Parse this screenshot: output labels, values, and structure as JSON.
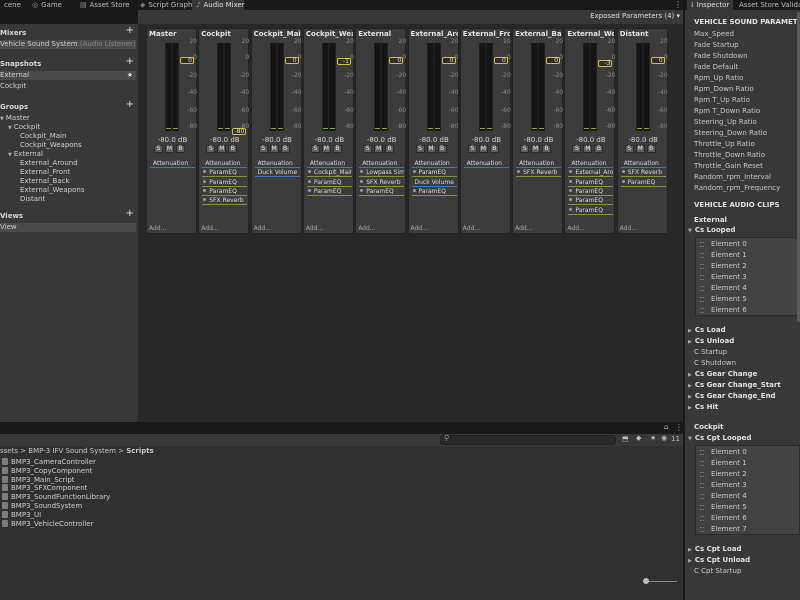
{
  "tabs": [
    {
      "label": "cene",
      "icon": "scene-icon",
      "active": false
    },
    {
      "label": "Game",
      "icon": "game-icon",
      "active": false
    },
    {
      "label": "Asset Store",
      "icon": "store-icon",
      "active": false
    },
    {
      "label": "Script Graph",
      "icon": "graph-icon",
      "active": false
    },
    {
      "label": "Audio Mixer",
      "icon": "mixer-icon",
      "active": true
    }
  ],
  "toolbar": {
    "exposed_params": "Exposed Parameters (4) ▾"
  },
  "left": {
    "mixers_title": "Mixers",
    "mixer_item": "Vehicle Sound System",
    "mixer_item_sub": "(Audio Listener) - Ii",
    "snapshots_title": "Snapshots",
    "snapshots": [
      "External",
      "Cockpit"
    ],
    "snapshot_star": "★",
    "groups_title": "Groups",
    "groups": [
      {
        "label": "Master",
        "indent": 0,
        "arrow": "▼"
      },
      {
        "label": "Cockpit",
        "indent": 1,
        "arrow": "▼"
      },
      {
        "label": "Cockpit_Main",
        "indent": 2,
        "arrow": ""
      },
      {
        "label": "Cockpit_Weapons",
        "indent": 2,
        "arrow": ""
      },
      {
        "label": "External",
        "indent": 1,
        "arrow": "▼"
      },
      {
        "label": "External_Around",
        "indent": 2,
        "arrow": ""
      },
      {
        "label": "External_Front",
        "indent": 2,
        "arrow": ""
      },
      {
        "label": "External_Back",
        "indent": 2,
        "arrow": ""
      },
      {
        "label": "External_Weapons",
        "indent": 2,
        "arrow": ""
      },
      {
        "label": "Distant",
        "indent": 2,
        "arrow": ""
      }
    ],
    "views_title": "Views",
    "views": [
      "View"
    ]
  },
  "meter_ticks": [
    "20",
    "0",
    "-20",
    "-40",
    "-60",
    "-80"
  ],
  "solo_mute_bypass": [
    "S",
    "M",
    "B"
  ],
  "add_label": "Add...",
  "strips": [
    {
      "name": "Master",
      "db": "-80.0 dB",
      "level": "0",
      "fader_db": 0,
      "effects": [
        {
          "label": "Attenuation",
          "plain": true,
          "dot": false
        }
      ]
    },
    {
      "name": "Cockpit",
      "db": "-80.0 dB",
      "level": "-80",
      "fader_db": -80,
      "effects": [
        {
          "label": "Attenuation",
          "plain": true,
          "dot": false
        },
        {
          "label": "ParamEQ",
          "plain": false,
          "dot": true
        },
        {
          "label": "ParamEQ",
          "plain": false,
          "dot": true
        },
        {
          "label": "ParamEQ",
          "plain": false,
          "dot": true
        },
        {
          "label": "SFX Reverb",
          "plain": false,
          "dot": true
        }
      ]
    },
    {
      "name": "Cockpit_Main",
      "db": "-80.0 dB",
      "level": "0",
      "fader_db": 0,
      "effects": [
        {
          "label": "Attenuation",
          "plain": true,
          "dot": false
        },
        {
          "label": "Duck Volume",
          "plain": true,
          "dot": false
        }
      ]
    },
    {
      "name": "Cockpit_Weap",
      "db": "-80.0 dB",
      "level": "-1",
      "fader_db": -1,
      "effects": [
        {
          "label": "Attenuation",
          "plain": true,
          "dot": false
        },
        {
          "label": "Cockpit_Main",
          "plain": false,
          "dot": true
        },
        {
          "label": "ParamEQ",
          "plain": false,
          "dot": true
        },
        {
          "label": "ParamEQ",
          "plain": false,
          "dot": true
        }
      ]
    },
    {
      "name": "External",
      "db": "-80.0 dB",
      "level": "0",
      "fader_db": 0,
      "effects": [
        {
          "label": "Attenuation",
          "plain": true,
          "dot": false
        },
        {
          "label": "Lowpass Sim",
          "plain": false,
          "dot": true
        },
        {
          "label": "SFX Reverb",
          "plain": false,
          "dot": true
        },
        {
          "label": "ParamEQ",
          "plain": false,
          "dot": true
        }
      ]
    },
    {
      "name": "External_Arou",
      "db": "-80.0 dB",
      "level": "0",
      "fader_db": 0,
      "effects": [
        {
          "label": "Attenuation",
          "plain": true,
          "dot": false
        },
        {
          "label": "ParamEQ",
          "plain": false,
          "dot": true
        },
        {
          "label": "Duck Volume",
          "plain": true,
          "dot": false
        },
        {
          "label": "ParamEQ",
          "plain": false,
          "dot": true
        }
      ]
    },
    {
      "name": "External_Fron",
      "db": "-80.0 dB",
      "level": "0",
      "fader_db": 0,
      "effects": [
        {
          "label": "Attenuation",
          "plain": true,
          "dot": false
        }
      ]
    },
    {
      "name": "External_Back",
      "db": "-80.0 dB",
      "level": "0",
      "fader_db": 0,
      "effects": [
        {
          "label": "Attenuation",
          "plain": true,
          "dot": false
        },
        {
          "label": "SFX Reverb",
          "plain": false,
          "dot": true
        }
      ]
    },
    {
      "name": "External_Weap",
      "db": "-80.0 dB",
      "level": "-3",
      "fader_db": -3,
      "effects": [
        {
          "label": "Attenuation",
          "plain": true,
          "dot": false
        },
        {
          "label": "External_Arou",
          "plain": false,
          "dot": true
        },
        {
          "label": "ParamEQ",
          "plain": false,
          "dot": true
        },
        {
          "label": "ParamEQ",
          "plain": false,
          "dot": true
        },
        {
          "label": "ParamEQ",
          "plain": false,
          "dot": true
        },
        {
          "label": "ParamEQ",
          "plain": false,
          "dot": true
        }
      ]
    },
    {
      "name": "Distant",
      "db": "-80.0 dB",
      "level": "0",
      "fader_db": 0,
      "effects": [
        {
          "label": "Attenuation",
          "plain": true,
          "dot": false
        },
        {
          "label": "SFX Reverb",
          "plain": false,
          "dot": true
        },
        {
          "label": "ParamEQ",
          "plain": false,
          "dot": true
        }
      ]
    }
  ],
  "project": {
    "breadcrumb": "ssets > BMP-3 IFV Sound System > ",
    "breadcrumb_last": "Scripts",
    "badge_count": "11",
    "files": [
      "BMP3_CameraController",
      "BMP3_CopyComponent",
      "BMP3_Main_Script",
      "BMP3_SFXComponent",
      "BMP3_SoundFunctionLibrary",
      "BMP3_SoundSystem",
      "BMP3_UI",
      "BMP3_VehicleController"
    ]
  },
  "inspector": {
    "tabs": [
      "Inspector",
      "Asset Store Validat"
    ],
    "params_title": "VEHICLE SOUND PARAMETERS",
    "params": [
      "Max_Speed",
      "Fade Startup",
      "Fade Shutdown",
      "Fade Default",
      "Rpm_Up Ratio",
      "Rpm_Down Ratio",
      "Rpm T_Up Ratio",
      "Rpm T_Down Ratio",
      "Steering_Up Ratio",
      "Steering_Down Ratio",
      "Throttle_Up Ratio",
      "Throttle_Down Ratio",
      "Throttle_Gain Reset",
      "Random_rpm_Interval",
      "Random_rpm_Frequency"
    ],
    "clips_title": "VEHICLE AUDIO CLIPS",
    "external_label": "External",
    "looped_label": "Cs Looped",
    "looped_elements": [
      "Element 0",
      "Element 1",
      "Element 2",
      "Element 3",
      "Element 4",
      "Element 5",
      "Element 6"
    ],
    "mid_items": [
      {
        "label": "Cs Load",
        "bold": true,
        "arrow": "▶"
      },
      {
        "label": "Cs Unload",
        "bold": true,
        "arrow": "▶"
      },
      {
        "label": "C Startup",
        "bold": false,
        "arrow": ""
      },
      {
        "label": "C Shutdown",
        "bold": false,
        "arrow": ""
      },
      {
        "label": "Cs Gear Change",
        "bold": true,
        "arrow": "▶"
      },
      {
        "label": "Cs Gear Change_Start",
        "bold": true,
        "arrow": "▶"
      },
      {
        "label": "Cs Gear Change_End",
        "bold": true,
        "arrow": "▶"
      },
      {
        "label": "Cs Hit",
        "bold": true,
        "arrow": "▶"
      }
    ],
    "cockpit_label": "Cockpit",
    "cpt_looped_label": "Cs Cpt Looped",
    "cpt_elements": [
      "Element 0",
      "Element 1",
      "Element 2",
      "Element 3",
      "Element 4",
      "Element 5",
      "Element 6",
      "Element 7"
    ],
    "bottom_items": [
      {
        "label": "Cs Cpt Load",
        "bold": true,
        "arrow": "▶"
      },
      {
        "label": "Cs Cpt Unload",
        "bold": true,
        "arrow": "▶"
      },
      {
        "label": "C Cpt Startup",
        "bold": false,
        "arrow": ""
      }
    ]
  }
}
